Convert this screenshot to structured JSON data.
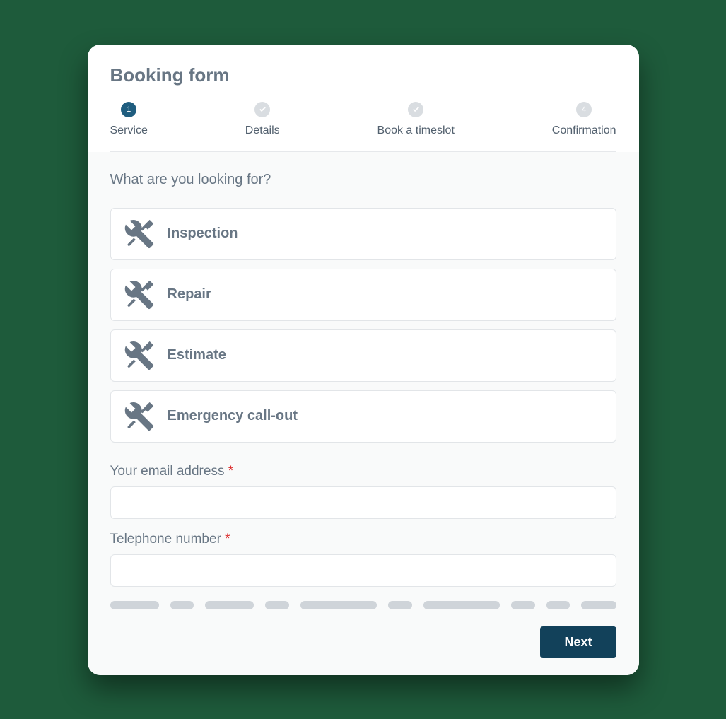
{
  "title": "Booking form",
  "stepper": {
    "steps": [
      {
        "label": "Service",
        "indicator": "1",
        "state": "active"
      },
      {
        "label": "Details",
        "indicator": "check",
        "state": "inactive"
      },
      {
        "label": "Book a timeslot",
        "indicator": "check",
        "state": "inactive"
      },
      {
        "label": "Confirmation",
        "indicator": "4",
        "state": "inactive"
      }
    ]
  },
  "question": "What are you looking for?",
  "options": [
    {
      "label": "Inspection",
      "icon": "tools-icon"
    },
    {
      "label": "Repair",
      "icon": "tools-icon"
    },
    {
      "label": "Estimate",
      "icon": "tools-icon"
    },
    {
      "label": "Emergency call-out",
      "icon": "tools-icon"
    }
  ],
  "fields": {
    "email": {
      "label": "Your email address",
      "required": true,
      "value": ""
    },
    "phone": {
      "label": "Telephone number",
      "required": true,
      "value": ""
    }
  },
  "requiredMark": "*",
  "skeletonWidths": [
    70,
    34,
    70,
    34,
    110,
    34,
    110,
    34,
    34,
    50
  ],
  "nextLabel": "Next"
}
